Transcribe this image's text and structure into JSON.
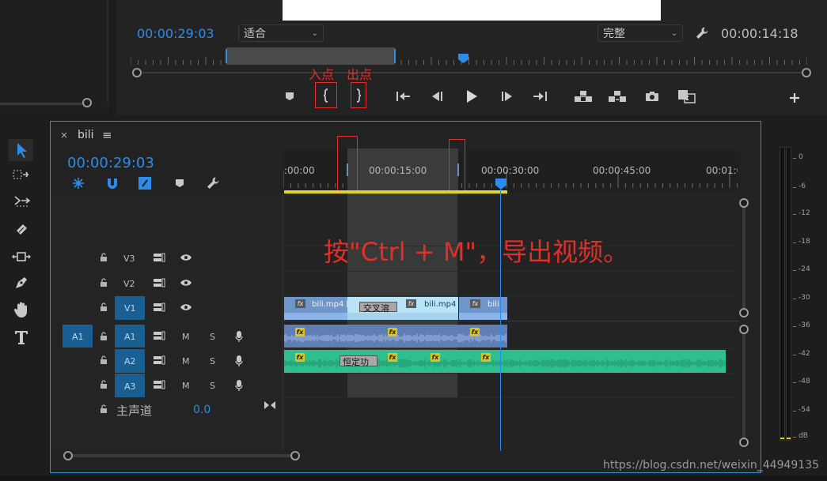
{
  "program_monitor": {
    "timecode_left": "00:00:29:03",
    "fit_dropdown": "适合",
    "quality_dropdown": "完整",
    "timecode_right": "00:00:14:18",
    "in_point_label": "入点",
    "out_point_label": "出点"
  },
  "timeline": {
    "close_x": "×",
    "sequence_name": "bili",
    "menu_icon": "≡",
    "timecode": "00:00:29:03",
    "ruler_labels": [
      ":00:00",
      "00:00:15:00",
      "00:00:30:00",
      "00:00:45:00",
      "00:01:0"
    ],
    "annotation": "按\"Ctrl + M\"，导出视频。",
    "tracks": {
      "v3": "V3",
      "v2": "V2",
      "v1": "V1",
      "a1_source": "A1",
      "a1": "A1",
      "a2": "A2",
      "a3": "A3",
      "m": "M",
      "s": "S",
      "master_label": "主声道",
      "master_value": "0.0"
    },
    "clips": {
      "v1_clip1": "bili.mp4 [V",
      "v1_transition": "交叉溶",
      "v1_clip2": "bili.mp4",
      "v1_clip3": "bili",
      "a2_transition": "恒定功",
      "fx": "fx"
    }
  },
  "audio_meter": {
    "labels": [
      "0",
      "-6",
      "-12",
      "-18",
      "-24",
      "-30",
      "-36",
      "-42",
      "-48",
      "-54",
      "dB"
    ]
  },
  "watermark": "https://blog.csdn.net/weixin_44949135",
  "colors": {
    "accent_blue": "#2d8ceb",
    "annotation_red": "#e0302a",
    "video_clip": "#8cb4e8",
    "audio_a1": "#5f7fb4",
    "audio_a2": "#2fbf8f",
    "workarea_yellow": "#e8d41c"
  }
}
